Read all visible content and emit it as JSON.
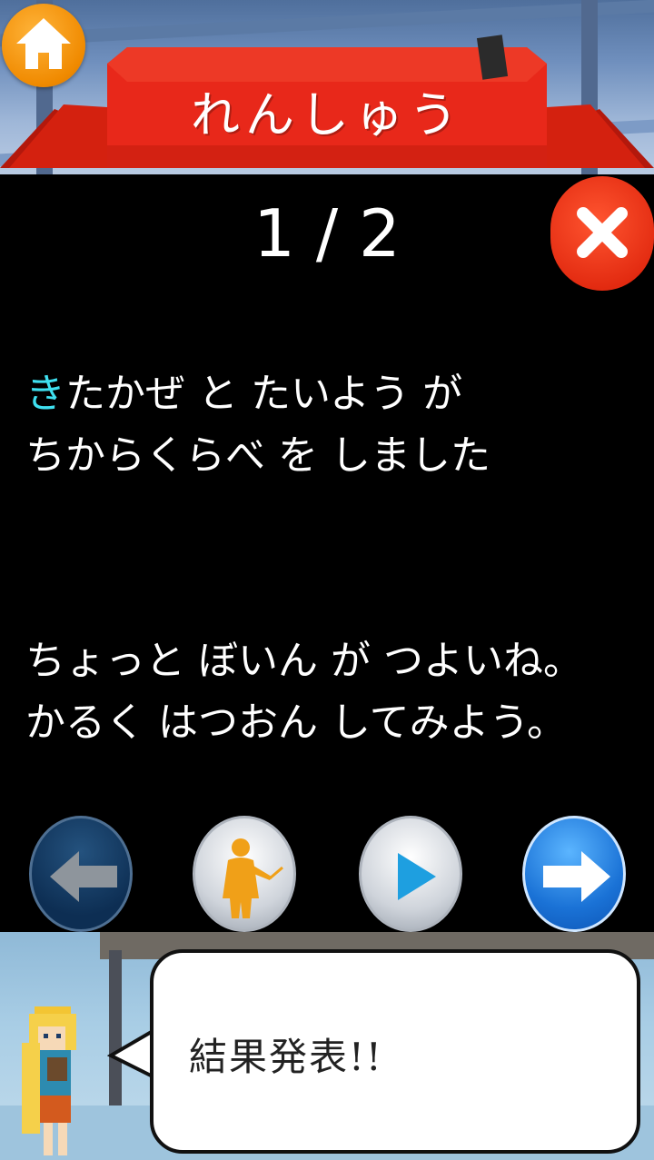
{
  "header": {
    "title": "れんしゅう",
    "home_icon": "home-icon"
  },
  "panel": {
    "counter": "1 / 2",
    "close_icon": "close-icon",
    "question": {
      "highlight": "き",
      "line1_rest": "たかぜ と たいよう が",
      "line2": "ちからくらべ を しました"
    },
    "feedback": {
      "line1": "ちょっと ぼいん が つよいね。",
      "line2": "かるく はつおん してみよう。"
    }
  },
  "controls": {
    "prev_icon": "left-arrow-icon",
    "teacher_icon": "teacher-icon",
    "play_icon": "play-icon",
    "next_icon": "right-arrow-icon"
  },
  "speech": {
    "text": "結果発表!!"
  },
  "colors": {
    "ribbon_red": "#e8281a",
    "home_orange": "#f08a00",
    "close_red": "#e22a10",
    "highlight_cyan": "#3fe0f0",
    "next_blue": "#1a72d6"
  }
}
